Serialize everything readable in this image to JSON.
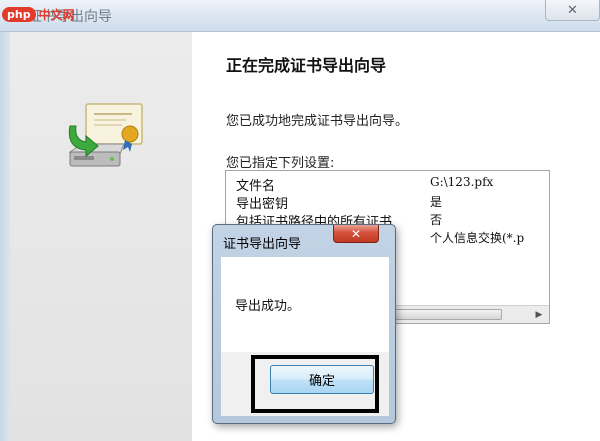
{
  "watermark": {
    "badge": "php",
    "text": "中文网"
  },
  "wizard": {
    "title": "证书导出向导",
    "close_symbol": "✕",
    "heading": "正在完成证书导出向导",
    "intro": "您已成功地完成证书导出向导。",
    "settings_label": "您已指定下列设置:",
    "settings": [
      {
        "key": "文件名",
        "value": "G:\\123.pfx"
      },
      {
        "key": "导出密钥",
        "value": "是"
      },
      {
        "key": "包括证书路径中的所有证书",
        "value": "否"
      },
      {
        "key": "",
        "value": "个人信息交换(*.p"
      }
    ]
  },
  "dialog": {
    "title": "证书导出向导",
    "close_symbol": "✕",
    "message": "导出成功。",
    "ok_label": "确定"
  },
  "icons": {
    "certificate": "certificate-export-icon",
    "close": "close-icon"
  },
  "colors": {
    "dialog_close": "#d5523c",
    "ok_button": "#bfe1f7",
    "highlight_border": "#000000"
  }
}
